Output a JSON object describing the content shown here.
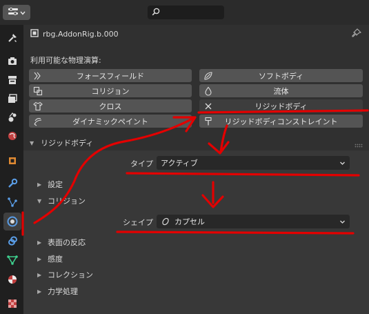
{
  "header": {
    "search_placeholder": ""
  },
  "tabs": [
    {
      "name": "tool-tab-icon"
    },
    {
      "name": "render-tab-icon"
    },
    {
      "name": "output-tab-icon"
    },
    {
      "name": "view-layer-tab-icon"
    },
    {
      "name": "scene-tab-icon"
    },
    {
      "name": "world-tab-icon"
    },
    {
      "name": "object-tab-icon"
    },
    {
      "name": "modifier-tab-icon"
    },
    {
      "name": "particles-tab-icon"
    },
    {
      "name": "physics-tab-icon"
    },
    {
      "name": "constraints-tab-icon"
    },
    {
      "name": "data-tab-icon"
    },
    {
      "name": "material-tab-icon"
    },
    {
      "name": "texture-tab-icon"
    }
  ],
  "object": {
    "name": "rbg.AddonRig.b.000"
  },
  "physics": {
    "section_label": "利用可能な物理演算:",
    "buttons": {
      "force_field": "フォースフィールド",
      "soft_body": "ソフトボディ",
      "collision": "コリジョン",
      "fluid": "流体",
      "cloth": "クロス",
      "rigid_body": "リジッドボディ",
      "dynamic_paint": "ダイナミックペイント",
      "rigid_body_constraint": "リジッドボディコンストレイント"
    }
  },
  "rigid_body_panel": {
    "title": "リジッドボディ",
    "type_label": "タイプ",
    "type_value": "アクティブ",
    "settings": "設定",
    "collision": "コリジョン",
    "shape_label": "シェイプ",
    "shape_value": "カプセル",
    "surface_response": "表面の反応",
    "sensitivity": "感度",
    "collections": "コレクション",
    "dynamics": "力学処理"
  },
  "annotation_color": "#e30000"
}
